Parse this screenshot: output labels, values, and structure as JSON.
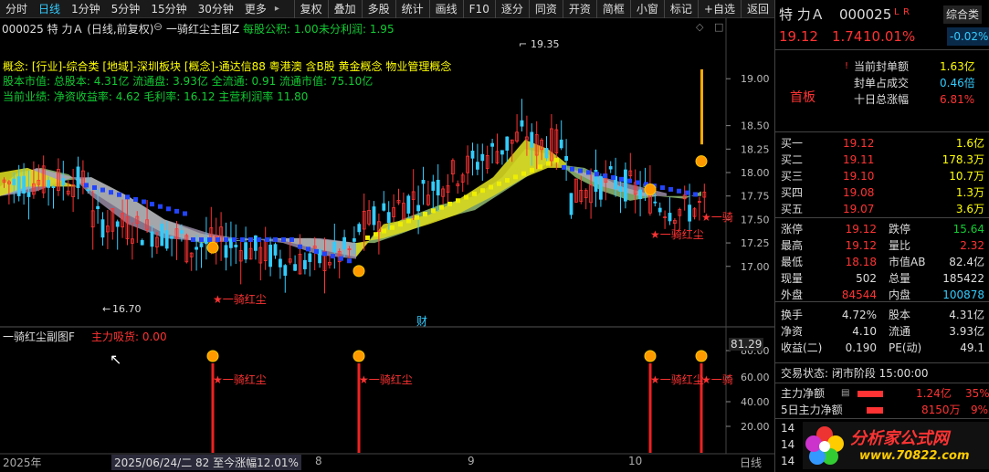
{
  "toolbar": {
    "items": [
      "分时",
      "日线",
      "1分钟",
      "5分钟",
      "15分钟",
      "30分钟",
      "更多"
    ],
    "active": "日线",
    "right_items": [
      "复权",
      "叠加",
      "多股",
      "统计",
      "画线",
      "F10",
      "逐分",
      "同资",
      "开资",
      "简框",
      "小窗",
      "标记",
      "+自选",
      "返回"
    ]
  },
  "main_chart": {
    "title": "000025 特 力Ａ (日线,前复权)",
    "indicator": "一骑红尘主图Z",
    "eps_label": "每股公积: 1.00",
    "undist_label": "未分利润: 1.95",
    "line1": "概念: [行业]-综合类 [地域]-深圳板块 [概念]-通达信88 粤港澳 含B股 黄金概念 物业管理概念",
    "line2": "股本市值: 总股本: 4.31亿 流通盘: 3.93亿 全流通: 0.91 流通市值: 75.10亿",
    "line3": "当前业绩: 净资收益率: 4.62 毛利率: 16.12 主营利润率 11.80",
    "high_label": "19.35",
    "low_label": "16.70",
    "signal_text": "★一骑红尘",
    "signal_text_short": "★一骑",
    "cai_label": "财",
    "y_ticks": [
      "19.00",
      "18.50",
      "18.25",
      "18.00",
      "17.75",
      "17.50",
      "17.25",
      "17.00"
    ],
    "y_tick_values": [
      19.0,
      18.5,
      18.25,
      18.0,
      17.75,
      17.5,
      17.25,
      17.0
    ]
  },
  "sub_chart": {
    "title": "一骑红尘副图F",
    "indicator_label": "主力吸货: 0.00",
    "top_value": "81.29",
    "y_ticks": [
      "80.00",
      "60.00",
      "40.00",
      "20.00"
    ],
    "signal_text": "★一骑红尘",
    "signal_text_short": "★一骑"
  },
  "x_axis": {
    "labels": [
      "2025年",
      "8",
      "9",
      "10",
      "日线"
    ],
    "cursor_info": "2025/06/24/二  82  至今涨幅12.01%"
  },
  "quote": {
    "name": "特 力Ａ",
    "code": "000025",
    "tags": [
      "L",
      "R"
    ],
    "sector": "综合类",
    "sector_change": "-0.02%",
    "price": "19.12",
    "change": "1.74",
    "pct": "10.01%",
    "board_label": "首板",
    "limit_items": [
      {
        "label": "当前封单额",
        "value": "1.63亿"
      },
      {
        "label": "封单占成交",
        "value": "0.46倍"
      },
      {
        "label": "十日总涨幅",
        "value": "6.81%"
      }
    ],
    "bids": [
      {
        "label": "买一",
        "price": "19.12",
        "vol": "1.6亿"
      },
      {
        "label": "买二",
        "price": "19.11",
        "vol": "178.3万"
      },
      {
        "label": "买三",
        "price": "19.10",
        "vol": "10.7万"
      },
      {
        "label": "买四",
        "price": "19.08",
        "vol": "1.3万"
      },
      {
        "label": "买五",
        "price": "19.07",
        "vol": "3.6万"
      }
    ],
    "stats_left": [
      {
        "label": "涨停",
        "value": "19.12"
      },
      {
        "label": "最高",
        "value": "19.12"
      },
      {
        "label": "最低",
        "value": "18.18"
      },
      {
        "label": "现量",
        "value": "502"
      },
      {
        "label": "外盘",
        "value": "84544"
      },
      {
        "label": "换手",
        "value": "4.72%"
      },
      {
        "label": "净资",
        "value": "4.10"
      },
      {
        "label": "收益(二)",
        "value": "0.190"
      }
    ],
    "stats_right": [
      {
        "label": "跌停",
        "value": "15.64"
      },
      {
        "label": "量比",
        "value": "2.32"
      },
      {
        "label": "市值AB",
        "value": "82.4亿"
      },
      {
        "label": "总量",
        "value": "185422"
      },
      {
        "label": "内盘",
        "value": "100878"
      },
      {
        "label": "股本",
        "value": "4.31亿"
      },
      {
        "label": "流通",
        "value": "3.93亿"
      },
      {
        "label": "PE(动)",
        "value": "49.1"
      }
    ],
    "status": "交易状态: 闭市阶段 15:00:00",
    "flows": [
      {
        "label": "主力净额",
        "value": "1.24亿",
        "pct": "35%"
      },
      {
        "label": "5日主力净额",
        "value": "8150万",
        "pct": "9%"
      }
    ],
    "extra_rows": [
      "14",
      "14",
      "14"
    ],
    "watermark": "分析家公式网",
    "watermark_url": "www.70822.com"
  },
  "colors": {
    "up": "#ff3333",
    "down": "#00ccff",
    "accent": "#ffff00",
    "green": "#11cc33"
  }
}
